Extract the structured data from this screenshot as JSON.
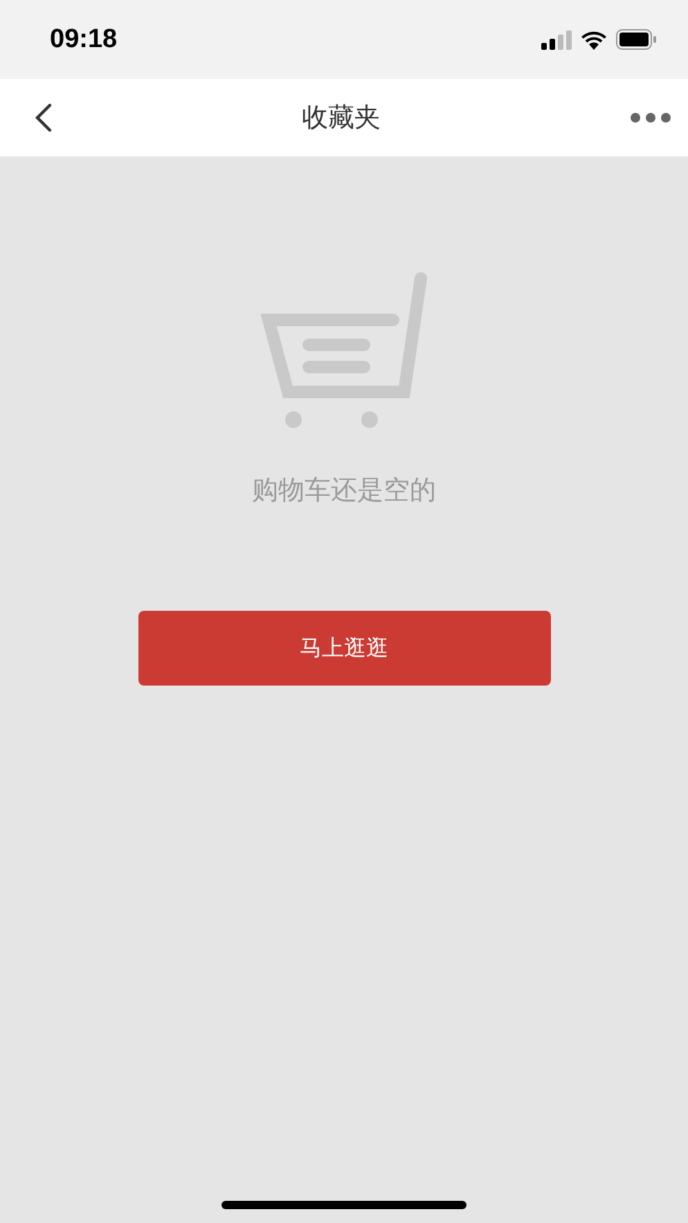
{
  "status_bar": {
    "time": "09:18"
  },
  "nav_bar": {
    "title": "收藏夹"
  },
  "empty_state": {
    "message": "购物车还是空的"
  },
  "button": {
    "label": "马上逛逛"
  }
}
